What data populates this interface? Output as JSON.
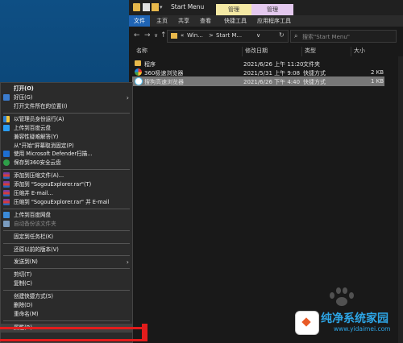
{
  "explorer": {
    "title": "Start Menu",
    "context_tabs": [
      "管理",
      "管理"
    ],
    "ribbon_tabs": [
      "文件",
      "主页",
      "共享",
      "查看",
      "快捷工具",
      "应用程序工具"
    ],
    "address": {
      "prefix": "«",
      "path1": "Win...",
      "sep": ">",
      "path2": "Start M...",
      "dropdown": "∨"
    },
    "search_placeholder": "搜索\"Start Menu\"",
    "columns": [
      "名称",
      "修改日期",
      "类型",
      "大小"
    ],
    "files": [
      {
        "icon": "folder-icon",
        "name": "程序",
        "date": "2021/6/26 上午 11:20",
        "type": "文件夹",
        "size": ""
      },
      {
        "icon": "360-browser-icon",
        "name": "360极速浏览器",
        "date": "2021/5/31 上午 9:08",
        "type": "快捷方式",
        "size": "2 KB"
      },
      {
        "icon": "sogou-browser-icon",
        "name": "搜狗高速浏览器",
        "date": "2021/6/26 下午 4:40",
        "type": "快捷方式",
        "size": "1 KB",
        "selected": true
      }
    ]
  },
  "menu": {
    "items": [
      {
        "label": "打开(O)",
        "bold": true
      },
      {
        "label": "好压(G)",
        "icon": "haozip",
        "arrow": true
      },
      {
        "label": "打开文件所在的位置(I)"
      },
      {
        "sep": true
      },
      {
        "label": "以管理员身份运行(A)",
        "icon": "shield"
      },
      {
        "label": "上传到百度云盘",
        "icon": "cloud"
      },
      {
        "label": "兼容性疑难解答(Y)"
      },
      {
        "label": "从\"开始\"屏幕取消固定(P)"
      },
      {
        "label": "使用 Microsoft Defender扫描...",
        "icon": "def"
      },
      {
        "label": "保存到360安全云盘",
        "icon": "s360"
      },
      {
        "sep": true
      },
      {
        "label": "添加到压缩文件(A)...",
        "icon": "rar"
      },
      {
        "label": "添加到 \"SogouExplorer.rar\"(T)",
        "icon": "rar"
      },
      {
        "label": "压缩并 E-mail...",
        "icon": "rar"
      },
      {
        "label": "压缩到 \"SogouExplorer.rar\" 并 E-mail",
        "icon": "rar"
      },
      {
        "sep": true
      },
      {
        "label": "上传到百度网盘",
        "icon": "cloud2"
      },
      {
        "label": "自动备份该文件夹",
        "icon": "cloud3",
        "disabled": true
      },
      {
        "sep": true
      },
      {
        "label": "固定到任务栏(K)"
      },
      {
        "sep": true
      },
      {
        "label": "还原以前的版本(V)"
      },
      {
        "sep": true
      },
      {
        "label": "发送到(N)",
        "arrow": true
      },
      {
        "sep": true
      },
      {
        "label": "剪切(T)"
      },
      {
        "label": "复制(C)"
      },
      {
        "sep": true
      },
      {
        "label": "创建快捷方式(S)"
      },
      {
        "label": "删除(D)"
      },
      {
        "label": "重命名(M)"
      },
      {
        "sep": true
      },
      {
        "label": "属性(R)",
        "highlighted": true
      }
    ]
  },
  "watermark": {
    "title": "纯净系统家园",
    "url": "www.yidaimei.com"
  },
  "colors": {
    "highlight_box": "#e21c1c",
    "file_tab": "#1f64b5",
    "watermark": "#2da5e6"
  }
}
